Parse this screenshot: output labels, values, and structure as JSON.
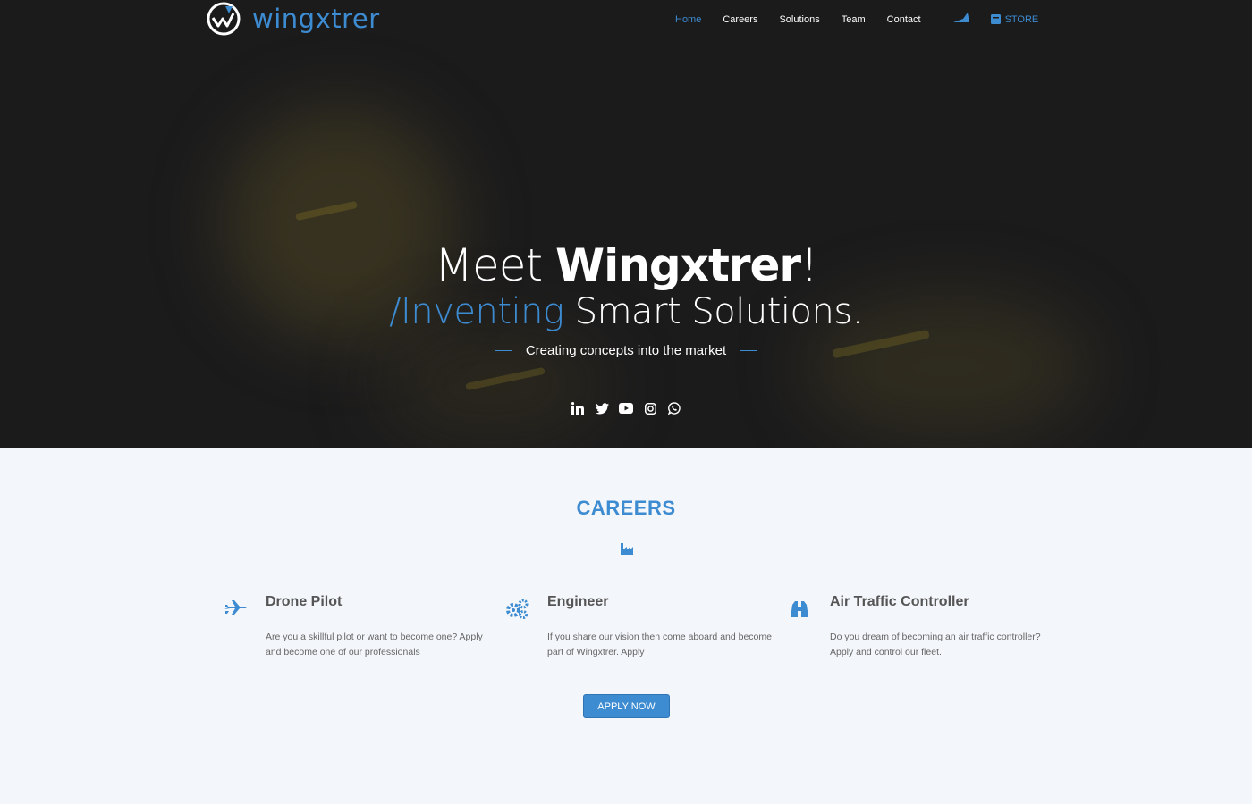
{
  "brand": {
    "name": "wingxtrer"
  },
  "nav": {
    "items": [
      {
        "label": "Home",
        "active": true
      },
      {
        "label": "Careers",
        "active": false
      },
      {
        "label": "Solutions",
        "active": false
      },
      {
        "label": "Team",
        "active": false
      },
      {
        "label": "Contact",
        "active": false
      }
    ],
    "store_label": "STORE"
  },
  "hero": {
    "title_prefix": "Meet ",
    "title_bold": "Wingxtrer",
    "title_suffix": "!",
    "subtitle_accent": "/Inventing",
    "subtitle_rest": " Smart Solutions.",
    "tagline": "Creating concepts into the market",
    "social": [
      "linkedin-icon",
      "twitter-icon",
      "youtube-icon",
      "instagram-icon",
      "whatsapp-icon"
    ]
  },
  "careers": {
    "title": "CAREERS",
    "cards": [
      {
        "icon": "airplane-icon",
        "title": "Drone Pilot",
        "text": "Are you a skillful pilot or want to become one? Apply and become one of our professionals"
      },
      {
        "icon": "gears-icon",
        "title": "Engineer",
        "text": "If you share our vision then come aboard and become part of Wingxtrer. Apply"
      },
      {
        "icon": "binoculars-icon",
        "title": "Air Traffic Controller",
        "text": "Do you dream of becoming an air traffic controller? Apply and control our fleet."
      }
    ],
    "apply_label": "APPLY NOW"
  },
  "colors": {
    "accent": "#3d8bd1",
    "hero_bg": "#1b1b1c",
    "section_bg": "#f3f6fa"
  }
}
